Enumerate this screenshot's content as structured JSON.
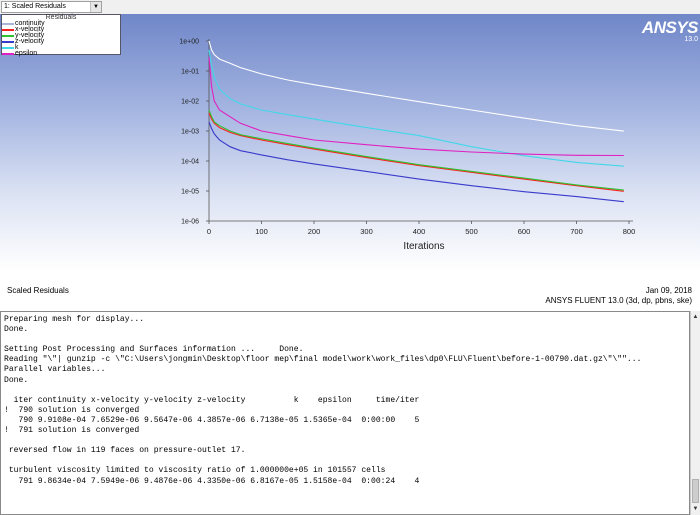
{
  "window": {
    "dropdown_label": "1: Scaled Residuals",
    "dropdown_arrow_icon": "chevron-down-icon"
  },
  "logo": {
    "name": "ANSYS",
    "version": "13.0"
  },
  "caption": {
    "left": "Scaled Residuals",
    "date": "Jan 09, 2018",
    "product": "ANSYS FLUENT 13.0 (3d, dp, pbns, ske)"
  },
  "chart_data": {
    "type": "line",
    "title": "",
    "xlabel": "Iterations",
    "ylabel": "",
    "xlim": [
      0,
      800
    ],
    "ylim": [
      1e-06,
      1
    ],
    "yscale": "log",
    "xticks": [
      "0",
      "100",
      "200",
      "300",
      "400",
      "500",
      "600",
      "700",
      "800"
    ],
    "yticks": [
      "1e+00",
      "1e-01",
      "1e-02",
      "1e-03",
      "1e-04",
      "1e-05",
      "1e-06"
    ],
    "legend": {
      "title": "Residuals",
      "placement": "top-left"
    },
    "series": [
      {
        "name": "continuity",
        "color": "#ffffff",
        "x": [
          0,
          5,
          10,
          20,
          40,
          60,
          100,
          150,
          200,
          300,
          400,
          500,
          600,
          700,
          790
        ],
        "y": [
          1.0,
          0.5,
          0.35,
          0.25,
          0.18,
          0.13,
          0.08,
          0.05,
          0.035,
          0.018,
          0.0095,
          0.005,
          0.0027,
          0.0015,
          0.00099
        ]
      },
      {
        "name": "x-velocity",
        "color": "#ff2020",
        "x": [
          0,
          5,
          10,
          20,
          40,
          60,
          100,
          150,
          200,
          300,
          400,
          500,
          600,
          700,
          790
        ],
        "y": [
          0.004,
          0.0025,
          0.0018,
          0.0013,
          0.0009,
          0.0007,
          0.0005,
          0.00035,
          0.00025,
          0.00013,
          7e-05,
          4.2e-05,
          2.5e-05,
          1.5e-05,
          9.8e-06
        ]
      },
      {
        "name": "y-velocity",
        "color": "#30c030",
        "x": [
          0,
          5,
          10,
          20,
          40,
          60,
          100,
          150,
          200,
          300,
          400,
          500,
          600,
          700,
          790
        ],
        "y": [
          0.005,
          0.003,
          0.002,
          0.0015,
          0.001,
          0.00075,
          0.00055,
          0.00038,
          0.00027,
          0.00014,
          7.5e-05,
          4.5e-05,
          2.7e-05,
          1.6e-05,
          1.07e-05
        ]
      },
      {
        "name": "z-velocity",
        "color": "#3a3acc",
        "x": [
          0,
          5,
          10,
          20,
          40,
          60,
          100,
          150,
          200,
          300,
          400,
          500,
          600,
          700,
          790
        ],
        "y": [
          0.002,
          0.0012,
          0.0008,
          0.0005,
          0.0003,
          0.00022,
          0.00016,
          0.00011,
          8e-05,
          4.5e-05,
          2.5e-05,
          1.5e-05,
          9.5e-06,
          6.5e-06,
          4.4e-06
        ]
      },
      {
        "name": "k",
        "color": "#40d8e8",
        "x": [
          0,
          5,
          10,
          20,
          40,
          60,
          100,
          150,
          200,
          300,
          400,
          500,
          600,
          700,
          790
        ],
        "y": [
          0.5,
          0.15,
          0.06,
          0.025,
          0.012,
          0.008,
          0.005,
          0.0035,
          0.0025,
          0.0013,
          0.0007,
          0.0003,
          0.00015,
          9e-05,
          6.7e-05
        ]
      },
      {
        "name": "epsilon",
        "color": "#e020c0",
        "x": [
          0,
          5,
          10,
          20,
          40,
          60,
          100,
          150,
          200,
          300,
          400,
          500,
          600,
          700,
          790
        ],
        "y": [
          0.3,
          0.03,
          0.01,
          0.005,
          0.003,
          0.0018,
          0.001,
          0.0007,
          0.0005,
          0.00035,
          0.00025,
          0.0002,
          0.00017,
          0.000155,
          0.000152
        ]
      }
    ]
  },
  "console": {
    "lines": [
      "Preparing mesh for display...",
      "Done.",
      "",
      "Setting Post Processing and Surfaces information ...     Done.",
      "Reading \"\\\"| gunzip -c \\\"C:\\Users\\jongmin\\Desktop\\floor mep\\final model\\work\\work_files\\dp0\\FLU\\Fluent\\before-1-00790.dat.gz\\\"\\\"\"...",
      "Parallel variables...",
      "Done.",
      "",
      "  iter continuity x-velocity y-velocity z-velocity          k    epsilon     time/iter",
      "!  790 solution is converged",
      "   790 9.9108e-04 7.6529e-06 9.5647e-06 4.3857e-06 6.7138e-05 1.5365e-04  0:00:00    5",
      "!  791 solution is converged",
      "",
      " reversed flow in 119 faces on pressure-outlet 17.",
      "",
      " turbulent viscosity limited to viscosity ratio of 1.000000e+05 in 101557 cells",
      "   791 9.8634e-04 7.5949e-06 9.4876e-06 4.3350e-06 6.8167e-05 1.5158e-04  0:00:24    4"
    ]
  }
}
